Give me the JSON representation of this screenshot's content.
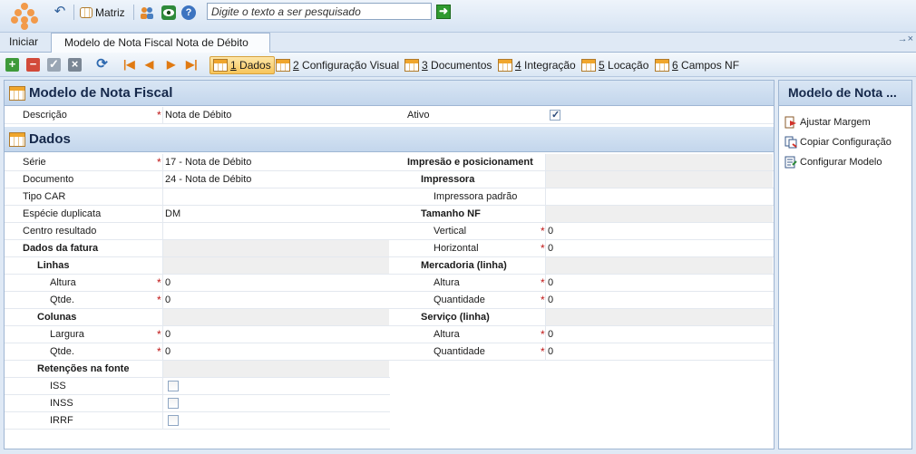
{
  "toolbar": {
    "matriz_label": "Matriz",
    "search_placeholder": "Digite o texto a ser pesquisado",
    "search_go": "➜"
  },
  "tabs": [
    {
      "label": "Iniciar"
    },
    {
      "label": "Modelo de Nota Fiscal Nota de Débito"
    }
  ],
  "pin_label": "→×",
  "actions": {
    "add": "+",
    "remove": "−",
    "check": "✓",
    "cancel": "×",
    "refresh": "⟳"
  },
  "view_tabs": [
    {
      "num": "1",
      "label": " Dados"
    },
    {
      "num": "2",
      "label": " Configuração Visual"
    },
    {
      "num": "3",
      "label": " Documentos"
    },
    {
      "num": "4",
      "label": " Integração"
    },
    {
      "num": "5",
      "label": " Locação"
    },
    {
      "num": "6",
      "label": " Campos NF"
    }
  ],
  "modelo": {
    "title": "Modelo de Nota Fiscal",
    "descricao_label": "Descrição",
    "descricao_value": "Nota de Débito",
    "ativo_label": "Ativo",
    "ativo_checked": true
  },
  "dados": {
    "title": "Dados",
    "left": [
      {
        "label": "Série",
        "value": "17 - Nota de Débito",
        "req": true
      },
      {
        "label": "Documento",
        "value": "24 - Nota de Débito"
      },
      {
        "label": "Tipo CAR",
        "value": ""
      },
      {
        "label": "Espécie duplicata",
        "value": "DM"
      },
      {
        "label": "Centro resultado",
        "value": ""
      },
      {
        "label": "Dados da fatura"
      },
      {
        "label": "Linhas"
      },
      {
        "label": "Altura",
        "value": "0",
        "req": true
      },
      {
        "label": "Qtde.",
        "value": "0",
        "req": true
      },
      {
        "label": "Colunas"
      },
      {
        "label": "Largura",
        "value": "0",
        "req": true
      },
      {
        "label": "Qtde.",
        "value": "0",
        "req": true
      },
      {
        "label": "Retenções na fonte"
      },
      {
        "label": "ISS",
        "checked": false
      },
      {
        "label": "INSS",
        "checked": false
      },
      {
        "label": "IRRF",
        "checked": false
      }
    ],
    "right": [
      {
        "label": "Impresão e posicionament"
      },
      {
        "label": "Impressora"
      },
      {
        "label": "Impressora padrão",
        "value": ""
      },
      {
        "label": "Tamanho NF"
      },
      {
        "label": "Vertical",
        "value": "0",
        "req": true
      },
      {
        "label": "Horizontal",
        "value": "0",
        "req": true
      },
      {
        "label": "Mercadoria (linha)"
      },
      {
        "label": "Altura",
        "value": "0",
        "req": true
      },
      {
        "label": "Quantidade",
        "value": "0",
        "req": true
      },
      {
        "label": "Serviço (linha)"
      },
      {
        "label": "Altura",
        "value": "0",
        "req": true
      },
      {
        "label": "Quantidade",
        "value": "0",
        "req": true
      }
    ]
  },
  "side": {
    "title": "Modelo de Nota ...",
    "items": [
      {
        "label": "Ajustar Margem"
      },
      {
        "label": "Copiar Configuração"
      },
      {
        "label": "Configurar Modelo"
      }
    ]
  },
  "colors": {
    "accent": "#f29a4a",
    "required": "#c01818",
    "header_text": "#15284a"
  }
}
